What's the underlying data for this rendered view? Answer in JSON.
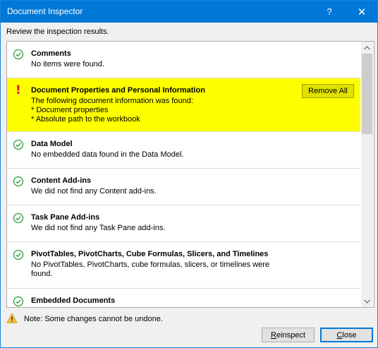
{
  "window": {
    "title": "Document Inspector",
    "help_glyph": "?",
    "close_glyph": "✕"
  },
  "intro": "Review the inspection results.",
  "items": [
    {
      "name": "Comments",
      "desc": "No items were found.",
      "status": "ok"
    },
    {
      "name": "Document Properties and Personal Information",
      "desc": "The following document information was found:\n* Document properties\n* Absolute path to the workbook",
      "status": "warning",
      "action_label": "Remove All"
    },
    {
      "name": "Data Model",
      "desc": "No embedded data found in the Data Model.",
      "status": "ok"
    },
    {
      "name": "Content Add-ins",
      "desc": "We did not find any Content add-ins.",
      "status": "ok"
    },
    {
      "name": "Task Pane Add-ins",
      "desc": "We did not find any Task Pane add-ins.",
      "status": "ok"
    },
    {
      "name": "PivotTables, PivotCharts, Cube Formulas, Slicers, and Timelines",
      "desc": "No PivotTables, PivotCharts, cube formulas, slicers, or timelines were\nfound.",
      "status": "ok"
    },
    {
      "name": "Embedded Documents",
      "desc": "",
      "status": "ok"
    }
  ],
  "note": "Note: Some changes cannot be undone.",
  "buttons": {
    "reinspect_first": "R",
    "reinspect_rest": "einspect",
    "close_first": "C",
    "close_rest": "lose"
  },
  "colors": {
    "titlebar": "#0078d7",
    "highlight": "#ffff00",
    "ok_check": "#2e9e3e",
    "warning": "#e81123"
  },
  "icons": {
    "ok": "check-circle-icon",
    "warning": "exclamation-icon",
    "note": "warning-triangle-icon"
  }
}
